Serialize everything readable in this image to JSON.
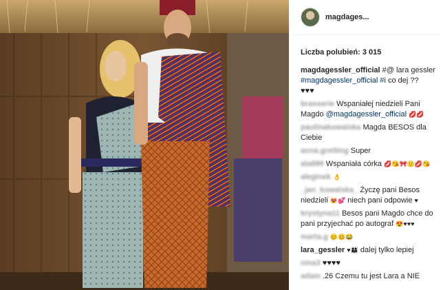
{
  "post": {
    "username": "magdages...",
    "likes_label": "Liczba polubień:",
    "likes_count": "3 015"
  },
  "caption": {
    "user": "magdagessler_official",
    "mention_line": "#@ lara gessler",
    "hashtags": "#magdagessler_official #i",
    "text": "co dej ??",
    "emoji": "♥♥♥"
  },
  "comments": [
    {
      "user": "brasserie",
      "text": "Wspaniałej niedzieli Pani Magdo",
      "mention": "@magdagessler_official",
      "emoji": "💋💋"
    },
    {
      "user": "paulinakowalska",
      "text": "Magda BESOS dla Ciebie",
      "emoji": ""
    },
    {
      "user": "anna.gretting",
      "text": "Super",
      "emoji": ""
    },
    {
      "user": "ala688",
      "text": "Wspaniała córka",
      "emoji": "💋😘🎀🙂💋😘"
    },
    {
      "user": "aleginek",
      "text": "",
      "emoji": "👌"
    },
    {
      "user": "_jan_kowalska_",
      "text": "Życzę pani Besos niedzieli",
      "emoji2": "😻💕",
      "text2": "niech pani odpowie",
      "emoji3": "♥"
    },
    {
      "user": "krystyna11",
      "text": "Besos pani Magdo chce do pani przyjechać po autograf",
      "emoji": "😍♥♥♥"
    },
    {
      "user": "marta.g",
      "text": "",
      "emoji": "😊😊😂"
    },
    {
      "user": "lara_gessler",
      "emoji": "♥👩‍👩‍👦",
      "text": "dalej tylko lepiej",
      "is_real": true
    },
    {
      "user": "nina3",
      "text": "",
      "emoji": "♥♥♥♥"
    },
    {
      "user": "adam",
      "text": ".26 Czemu tu jest Lara a NIE",
      "emoji": ""
    }
  ]
}
